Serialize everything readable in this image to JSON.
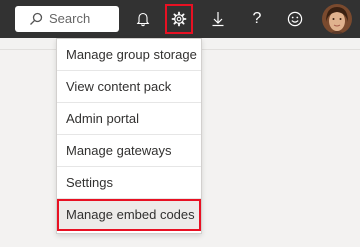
{
  "topbar": {
    "search_placeholder": "Search",
    "icons": [
      "bell-icon",
      "gear-icon",
      "download-icon",
      "help-icon",
      "smiley-icon"
    ],
    "help_glyph": "?",
    "highlight_color": "#e81123"
  },
  "settings_menu": {
    "items": [
      {
        "label": "Manage group storage"
      },
      {
        "label": "View content pack"
      },
      {
        "label": "Admin portal"
      },
      {
        "label": "Manage gateways"
      },
      {
        "label": "Settings"
      },
      {
        "label": "Manage embed codes",
        "highlighted": true
      }
    ]
  }
}
